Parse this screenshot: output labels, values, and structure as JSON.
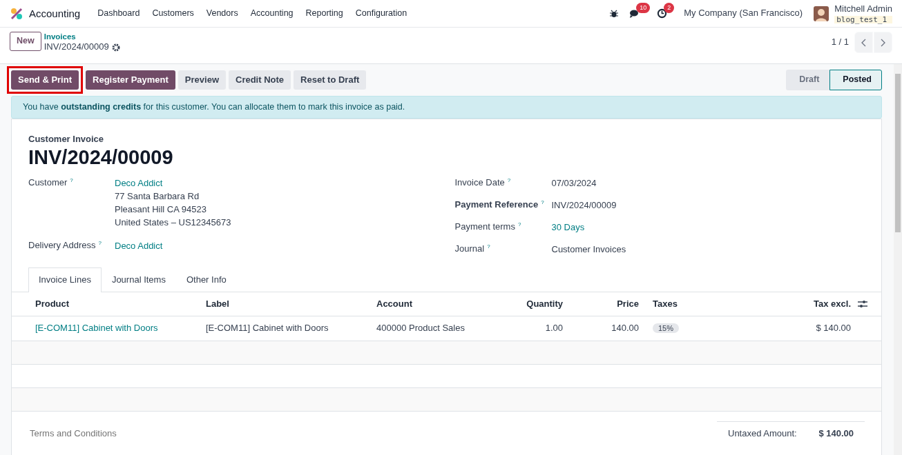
{
  "navbar": {
    "app": "Accounting",
    "menu": [
      "Dashboard",
      "Customers",
      "Vendors",
      "Accounting",
      "Reporting",
      "Configuration"
    ],
    "messages_count": "10",
    "activities_count": "2",
    "company": "My Company (San Francisco)",
    "user": "Mitchell Admin",
    "database": "blog_test_1"
  },
  "control_panel": {
    "new_button": "New",
    "breadcrumb": "Invoices",
    "record": "INV/2024/00009",
    "pager": "1 / 1"
  },
  "actions": [
    {
      "label": "Send & Print",
      "kind": "primary",
      "highlighted": true
    },
    {
      "label": "Register Payment",
      "kind": "primary",
      "highlighted": false
    },
    {
      "label": "Preview",
      "kind": "secondary",
      "highlighted": false
    },
    {
      "label": "Credit Note",
      "kind": "secondary",
      "highlighted": false
    },
    {
      "label": "Reset to Draft",
      "kind": "secondary",
      "highlighted": false
    }
  ],
  "status": [
    {
      "label": "Draft",
      "selected": false
    },
    {
      "label": "Posted",
      "selected": true
    }
  ],
  "alert": "You have **outstanding credits** for this customer. You can allocate them to mark this invoice as paid.",
  "sheet": {
    "type": "Customer Invoice",
    "number": "INV/2024/00009",
    "left_fields": [
      {
        "label": "Customer",
        "help": "?",
        "lines": [
          "Deco Addict",
          "77 Santa Barbara Rd",
          "Pleasant Hill CA 94523",
          "United States – US12345673"
        ],
        "link": true,
        "bold": false
      },
      {
        "label": "Delivery Address",
        "help": "?",
        "lines": [
          "Deco Addict"
        ],
        "link": true,
        "bold": false
      }
    ],
    "right_fields": [
      {
        "label": "Invoice Date",
        "help": "?",
        "lines": [
          "07/03/2024"
        ],
        "link": false,
        "bold": false
      },
      {
        "label": "Payment Reference",
        "help": "?",
        "lines": [
          "INV/2024/00009"
        ],
        "link": false,
        "bold": true
      },
      {
        "label": "Payment terms",
        "help": "?",
        "lines": [
          "30 Days"
        ],
        "link": true,
        "bold": false
      },
      {
        "label": "Journal",
        "help": "?",
        "lines": [
          "Customer Invoices"
        ],
        "link": false,
        "bold": false
      }
    ],
    "tabs": [
      {
        "label": "Invoice Lines",
        "selected": true
      },
      {
        "label": "Journal Items",
        "selected": false
      },
      {
        "label": "Other Info",
        "selected": false
      }
    ],
    "table": {
      "columns": [
        "Product",
        "Label",
        "Account",
        "Quantity",
        "Price",
        "Taxes",
        "Tax excl."
      ],
      "rows": [
        {
          "product": "[E-COM11] Cabinet with Doors",
          "label": "[E-COM11] Cabinet with Doors",
          "account": "400000 Product Sales",
          "quantity": "1.00",
          "price": "140.00",
          "taxes": [
            "15%"
          ],
          "subtotal": "$ 140.00"
        }
      ]
    },
    "terms_placeholder": "Terms and Conditions",
    "totals": [
      {
        "label": "Untaxed Amount:",
        "value": "$ 140.00"
      }
    ]
  }
}
